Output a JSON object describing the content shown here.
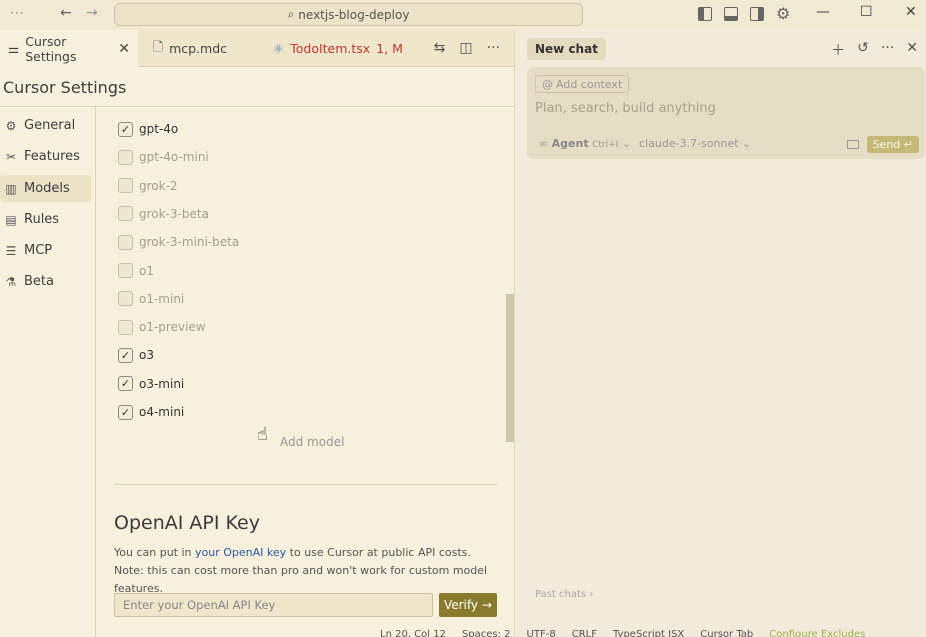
{
  "titlebar": {
    "search_text": "nextjs-blog-deploy",
    "min": "—",
    "max": "☐",
    "close": "✕"
  },
  "tabs": [
    {
      "label": "Cursor Settings"
    },
    {
      "label": "mcp.mdc"
    },
    {
      "label": "TodoItem.tsx",
      "badge": "1, M"
    }
  ],
  "settings": {
    "title": "Cursor Settings",
    "nav": [
      {
        "label": "General",
        "icon": "gear-icon"
      },
      {
        "label": "Features",
        "icon": "tools-icon"
      },
      {
        "label": "Models",
        "icon": "chart-icon"
      },
      {
        "label": "Rules",
        "icon": "book-icon"
      },
      {
        "label": "MCP",
        "icon": "server-icon"
      },
      {
        "label": "Beta",
        "icon": "flask-icon"
      }
    ],
    "models": [
      {
        "name": "gpt-4o",
        "checked": true
      },
      {
        "name": "gpt-4o-mini",
        "checked": false
      },
      {
        "name": "grok-2",
        "checked": false
      },
      {
        "name": "grok-3-beta",
        "checked": false
      },
      {
        "name": "grok-3-mini-beta",
        "checked": false
      },
      {
        "name": "o1",
        "checked": false
      },
      {
        "name": "o1-mini",
        "checked": false
      },
      {
        "name": "o1-preview",
        "checked": false
      },
      {
        "name": "o3",
        "checked": true
      },
      {
        "name": "o3-mini",
        "checked": true
      },
      {
        "name": "o4-mini",
        "checked": true
      }
    ],
    "add_model": "Add model",
    "api": {
      "title": "OpenAI API Key",
      "desc_pre": "You can put in ",
      "desc_link": "your OpenAI key",
      "desc_post": " to use Cursor at public API costs. Note: this can cost more than pro and won't work for custom model features.",
      "placeholder": "Enter your OpenAI API Key",
      "verify": "Verify"
    }
  },
  "chat": {
    "new_chat": "New chat",
    "add_context": "Add context",
    "placeholder": "Plan, search, build anything",
    "agent": "Agent",
    "agent_shortcut": "Ctrl+I",
    "model": "claude-3.7-sonnet",
    "send": "Send",
    "past_chats": "Past chats"
  },
  "status": {
    "position": "Ln 20, Col 12",
    "spaces": "Spaces: 2",
    "encoding": "UTF-8",
    "eol": "CRLF",
    "lang": "TypeScript JSX",
    "cursor_tab": "Cursor Tab",
    "excludes": "Configure Excludes"
  }
}
